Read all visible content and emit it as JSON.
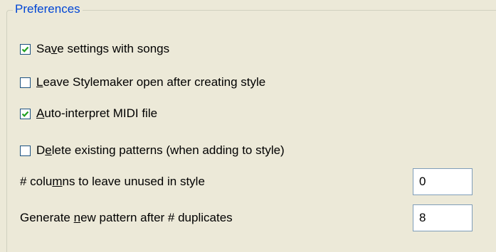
{
  "group": {
    "title": "Preferences"
  },
  "options": [
    {
      "pre": "Sa",
      "acc": "v",
      "post": "e settings with songs",
      "checked": true
    },
    {
      "pre": "",
      "acc": "L",
      "post": "eave Stylemaker open after creating style",
      "checked": false
    },
    {
      "pre": "",
      "acc": "A",
      "post": "uto-interpret MIDI file",
      "checked": true
    },
    {
      "pre": "D",
      "acc": "e",
      "post": "lete existing patterns (when adding to style)",
      "checked": false
    }
  ],
  "fields": [
    {
      "pre": "# colu",
      "acc": "m",
      "post": "ns to leave unused in style",
      "value": "0"
    },
    {
      "pre": "Generate ",
      "acc": "n",
      "post": "ew pattern after # duplicates",
      "value": "8"
    }
  ]
}
